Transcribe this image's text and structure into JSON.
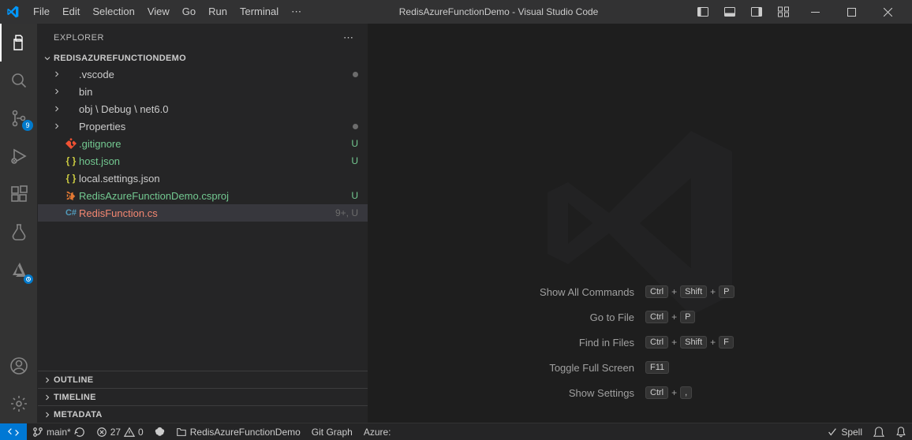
{
  "window": {
    "title": "RedisAzureFunctionDemo - Visual Studio Code"
  },
  "menu": {
    "file": "File",
    "edit": "Edit",
    "selection": "Selection",
    "view": "View",
    "go": "Go",
    "run": "Run",
    "terminal": "Terminal"
  },
  "activity": {
    "scm_badge": "9"
  },
  "sidebar": {
    "title": "EXPLORER",
    "root": "REDISAZUREFUNCTIONDEMO",
    "items": [
      {
        "kind": "folder",
        "label": ".vscode",
        "deco": "dot"
      },
      {
        "kind": "folder",
        "label": "bin",
        "deco": ""
      },
      {
        "kind": "folder",
        "label": "obj \\ Debug \\ net6.0",
        "deco": ""
      },
      {
        "kind": "folder",
        "label": "Properties",
        "deco": "dot"
      },
      {
        "kind": "file",
        "icon": "git",
        "label": ".gitignore",
        "status": "untracked",
        "deco": "U"
      },
      {
        "kind": "file",
        "icon": "json",
        "label": "host.json",
        "status": "untracked",
        "deco": "U"
      },
      {
        "kind": "file",
        "icon": "json",
        "label": "local.settings.json",
        "status": "",
        "deco": ""
      },
      {
        "kind": "file",
        "icon": "xml",
        "label": "RedisAzureFunctionDemo.csproj",
        "status": "untracked",
        "deco": "U"
      },
      {
        "kind": "file",
        "icon": "cs",
        "label": "RedisFunction.cs",
        "status": "error",
        "deco": "9+, U",
        "selected": true
      }
    ],
    "sections": {
      "outline": "OUTLINE",
      "timeline": "TIMELINE",
      "metadata": "METADATA"
    }
  },
  "welcome": {
    "rows": [
      {
        "label": "Show All Commands",
        "keys": [
          "Ctrl",
          "+",
          "Shift",
          "+",
          "P"
        ]
      },
      {
        "label": "Go to File",
        "keys": [
          "Ctrl",
          "+",
          "P"
        ]
      },
      {
        "label": "Find in Files",
        "keys": [
          "Ctrl",
          "+",
          "Shift",
          "+",
          "F"
        ]
      },
      {
        "label": "Toggle Full Screen",
        "keys": [
          "F11"
        ]
      },
      {
        "label": "Show Settings",
        "keys": [
          "Ctrl",
          "+",
          ","
        ]
      }
    ]
  },
  "status": {
    "branch": "main*",
    "errors": "27",
    "warnings": "0",
    "folder": "RedisAzureFunctionDemo",
    "gitgraph": "Git Graph",
    "azure": "Azure:",
    "spell": "Spell"
  }
}
